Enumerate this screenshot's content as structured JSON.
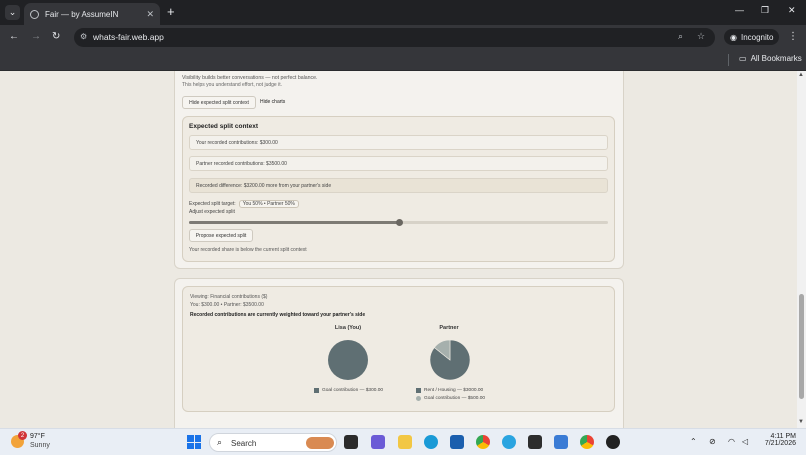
{
  "browser": {
    "tab_title": "Fair — by AssumeIN",
    "url": "whats-fair.web.app",
    "incognito_label": "Incognito",
    "bookmarks_label": "All Bookmarks"
  },
  "intro": {
    "text": "Visibility builds better conversations — not perfect balance.",
    "subtext": "This helps you understand effort, not judge it.",
    "hide_split_label": "Hide expected split context",
    "hide_charts_label": "Hide charts"
  },
  "split": {
    "title": "Expected split context",
    "your_contrib": "Your recorded contributions: $300.00",
    "partner_contrib": "Partner recorded contributions: $3500.00",
    "difference": "Recorded difference: $3200.00 more from your partner's side",
    "target_label": "Expected split target:",
    "target_value": "You 50% • Partner 50%",
    "adjust_label": "Adjust expected split",
    "slider_value": 50,
    "propose_label": "Propose expected split",
    "note": "Your recorded share is below the current split context"
  },
  "charts": {
    "viewing": "Viewing: Financial contributions ($)",
    "totals": "You: $300.00 • Partner: $3500.00",
    "headline": "Recorded contributions are currently weighted toward your partner's side"
  },
  "chart_data": [
    {
      "type": "pie",
      "title": "Lisa (You)",
      "categories": [
        "Goal contribution"
      ],
      "values": [
        300
      ],
      "legend": [
        "Goal contribution — $300.00"
      ],
      "colors": [
        "#5f6f73"
      ]
    },
    {
      "type": "pie",
      "title": "Partner",
      "categories": [
        "Rent / Housing",
        "Goal contribution"
      ],
      "values": [
        3000,
        500
      ],
      "legend": [
        "Rent / Housing — $3000.00",
        "Goal contribution — $500.00"
      ],
      "colors": [
        "#5f6f73",
        "#a6b0ad"
      ]
    }
  ],
  "taskbar": {
    "temp": "97°F",
    "condition": "Sunny",
    "weather_badge": "2",
    "search_label": "Search",
    "time": "4:11 PM",
    "date": "7/21/2026"
  }
}
